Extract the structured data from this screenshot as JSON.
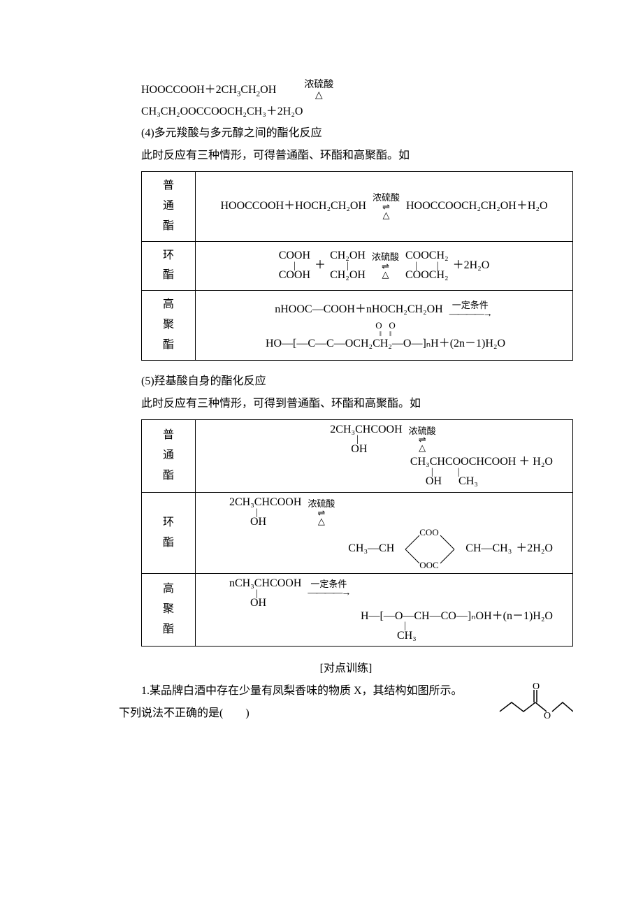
{
  "line1_left": "HOOCCOOH＋2CH",
  "line1_sub1": "3",
  "line1_mid": "CH",
  "line1_sub2": "2",
  "line1_right": "OH",
  "cond_top": "浓硫酸",
  "cond_bot": "△",
  "line2": "CH₃CH₂OOCCOOCH₂CH₃＋2H₂O",
  "heading4": "(4)多元羧酸与多元醇之间的酯化反应",
  "intro4": "此时反应有三种情形，可得普通酯、环酯和高聚酯。如",
  "table1": {
    "row1_label": "普<br>通<br>酯",
    "row1_lhs": "HOOCCOOH＋HOCH₂CH₂OH",
    "row1_rhs": "HOOCCOOCH₂CH₂OH＋H₂O",
    "row2_label": "环<br>酯",
    "row2_a_top": "COOH",
    "row2_a_bot": "COOH",
    "row2_plus": "＋",
    "row2_b_top": "CH₂OH",
    "row2_b_bot": "CH₂OH",
    "row2_c_top": "COOCH₂",
    "row2_c_bot": "COOCH₂",
    "row2_tail": "＋2H₂O",
    "row3_label": "高<br>聚<br>酯",
    "row3_line1": "nHOOC—COOH＋nHOCH₂CH₂OH",
    "row3_cond": "一定条件",
    "row3_o": "O",
    "row3_line3": "HO—[—C—C—OCH₂CH₂—O—]ₙH＋(2n－1)H₂O"
  },
  "heading5": "(5)羟基酸自身的酯化反应",
  "intro5": "此时反应有三种情形，可得到普通酯、环酯和高聚酯。如",
  "table2": {
    "row1_label": "普<br>通<br>酯",
    "reactant_top": "2CH₃CHCOOH",
    "reactant_oh": "OH",
    "row1_prod_top": "CH₃CHCOOCHCOOH ＋ H₂O",
    "row1_prod_b1": "OH",
    "row1_prod_b2": "CH₃",
    "row2_label": "环<br>酯",
    "hex_top": "COO",
    "hex_bot": "OOC",
    "hex_left": "CH₃—CH",
    "hex_right": "CH—CH₃",
    "row2_tail": "＋2H₂O",
    "row3_label": "高<br>聚<br>酯",
    "row3_lhs_top": "nCH₃CHCOOH",
    "row3_cond": "一定条件",
    "row3_prod_top": "H—[—O—CH—CO—]ₙOH＋(n－1)H₂O",
    "row3_prod_bot": "CH₃"
  },
  "practice_title": "[对点训练]",
  "q1_text": "1.某品牌白酒中存在少量有凤梨香味的物质 X，其结构如图所示。下列说法不正确的是(　　)"
}
